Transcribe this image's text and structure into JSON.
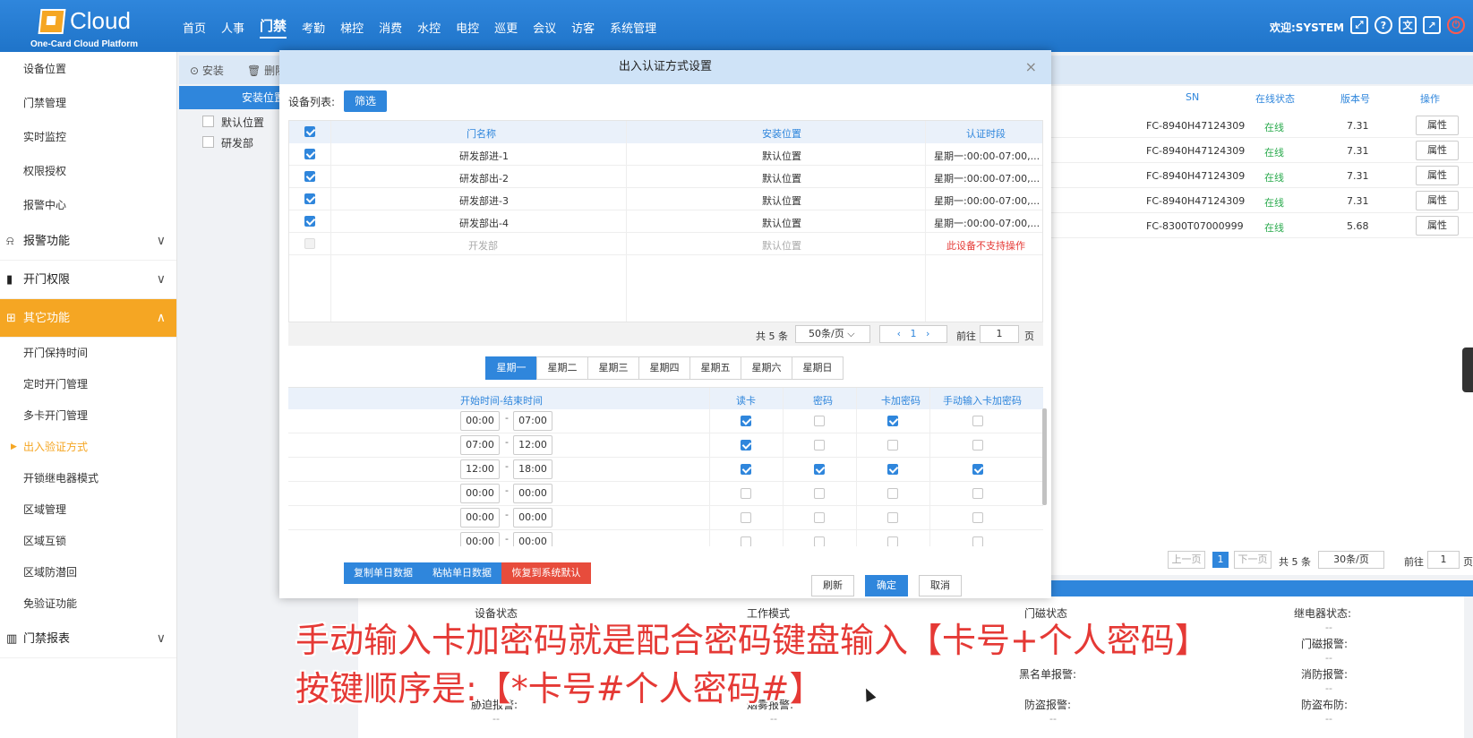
{
  "app": {
    "logo_text": "Cloud",
    "logo_sub": "One-Card Cloud Platform",
    "nav": [
      "首页",
      "人事",
      "门禁",
      "考勤",
      "梯控",
      "消费",
      "水控",
      "电控",
      "巡更",
      "会议",
      "访客",
      "系统管理"
    ],
    "welcome": "欢迎:SYSTEM",
    "brand_color": "#2f86dc",
    "accent_color": "#f5a623"
  },
  "sidebar": {
    "top_items": [
      "设备位置",
      "门禁管理",
      "实时监控",
      "权限授权",
      "报警中心"
    ],
    "groups": [
      {
        "label": "报警功能",
        "icon": "alarm-icon"
      },
      {
        "label": "开门权限",
        "icon": "door-icon"
      },
      {
        "label": "其它功能",
        "icon": "grid-icon"
      }
    ],
    "sub_items": [
      "开门保持时间",
      "定时开门管理",
      "多卡开门管理",
      "出入验证方式",
      "开锁继电器模式",
      "区域管理",
      "区域互锁",
      "区域防潜回",
      "免验证功能"
    ],
    "report_group": "门禁报表"
  },
  "page": {
    "toolbar": {
      "install": "安装",
      "delete": "删除"
    },
    "tree_head": "安装位置",
    "tree_nodes": [
      "默认位置",
      "研发部"
    ],
    "grid": {
      "headers": {
        "sn": "SN",
        "online": "在线状态",
        "version": "版本号",
        "op": "操作"
      },
      "rows": [
        {
          "sn": "FC-8940H47124309",
          "status": "在线",
          "ver": "7.31",
          "op": "属性"
        },
        {
          "sn": "FC-8940H47124309",
          "status": "在线",
          "ver": "7.31",
          "op": "属性"
        },
        {
          "sn": "FC-8940H47124309",
          "status": "在线",
          "ver": "7.31",
          "op": "属性"
        },
        {
          "sn": "FC-8940H47124309",
          "status": "在线",
          "ver": "7.31",
          "op": "属性"
        },
        {
          "sn": "FC-8300T07000999",
          "status": "在线",
          "ver": "5.68",
          "op": "属性"
        }
      ]
    },
    "pager": {
      "prev": "上一页",
      "cur": "1",
      "next": "下一页",
      "total": "共 5 条",
      "size": "30条/页",
      "goto": "前往",
      "page_val": "1",
      "page_unit": "页"
    },
    "status": {
      "labels": [
        "设备状态",
        "工作模式",
        "门磁状态",
        "继电器状态:",
        "门磁报警:",
        "黑名单报警:",
        "消防报警:",
        "胁迫报警:",
        "烟雾报警:",
        "防盗报警:",
        "防盗布防:"
      ],
      "empty": "--"
    }
  },
  "modal": {
    "title": "出入认证方式设置",
    "close": "×",
    "device_list_label": "设备列表:",
    "filter_btn": "筛选",
    "table": {
      "headers": {
        "door": "门名称",
        "location": "安装位置",
        "period": "认证时段"
      },
      "rows": [
        {
          "door": "研发部进-1",
          "location": "默认位置",
          "period": "星期一:00:00-07:00,...",
          "checked": true,
          "disabled": false
        },
        {
          "door": "研发部出-2",
          "location": "默认位置",
          "period": "星期一:00:00-07:00,...",
          "checked": true,
          "disabled": false
        },
        {
          "door": "研发部进-3",
          "location": "默认位置",
          "period": "星期一:00:00-07:00,...",
          "checked": true,
          "disabled": false
        },
        {
          "door": "研发部出-4",
          "location": "默认位置",
          "period": "星期一:00:00-07:00,...",
          "checked": true,
          "disabled": false
        },
        {
          "door": "开发部",
          "location": "默认位置",
          "period": "此设备不支持操作",
          "checked": false,
          "disabled": true
        }
      ]
    },
    "pager": {
      "total": "共 5 条",
      "size": "50条/页",
      "cur": "1",
      "goto": "前往",
      "page_val": "1",
      "page_unit": "页"
    },
    "days": [
      "星期一",
      "星期二",
      "星期三",
      "星期四",
      "星期五",
      "星期六",
      "星期日"
    ],
    "active_day": "星期一",
    "time_table": {
      "headers": {
        "time": "开始时间-结束时间",
        "card": "读卡",
        "pwd": "密码",
        "card_pwd": "卡加密码",
        "manual": "手动输入卡加密码"
      },
      "rows": [
        {
          "start": "00:00",
          "end": "07:00",
          "card": true,
          "pwd": false,
          "card_pwd": true,
          "manual": false
        },
        {
          "start": "07:00",
          "end": "12:00",
          "card": true,
          "pwd": false,
          "card_pwd": false,
          "manual": false
        },
        {
          "start": "12:00",
          "end": "18:00",
          "card": true,
          "pwd": true,
          "card_pwd": true,
          "manual": true
        },
        {
          "start": "00:00",
          "end": "00:00",
          "card": false,
          "pwd": false,
          "card_pwd": false,
          "manual": false
        },
        {
          "start": "00:00",
          "end": "00:00",
          "card": false,
          "pwd": false,
          "card_pwd": false,
          "manual": false
        },
        {
          "start": "00:00",
          "end": "00:00",
          "card": false,
          "pwd": false,
          "card_pwd": false,
          "manual": false
        }
      ]
    },
    "buttons": {
      "copy": "复制单日数据",
      "paste": "粘帖单日数据",
      "restore": "恢复到系统默认",
      "refresh": "刷新",
      "ok": "确定",
      "cancel": "取消"
    }
  },
  "subtitles": {
    "line1": "手动输入卡加密码就是配合密码键盘输入【卡号+个人密码】",
    "line2": "按键顺序是:【*卡号#个人密码#】"
  }
}
